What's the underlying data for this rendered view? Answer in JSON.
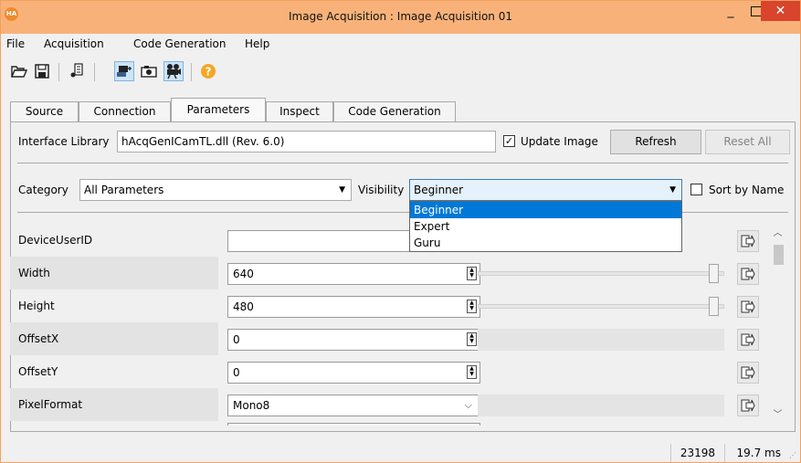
{
  "window": {
    "app_icon_text": "HA",
    "title": "Image Acquisition : Image Acquisition 01",
    "min_label": "_",
    "close_label": "✕"
  },
  "menu": {
    "items": [
      {
        "label": "File"
      },
      {
        "label": "Acquisition"
      },
      {
        "label": "Code Generation"
      },
      {
        "label": "Help"
      }
    ]
  },
  "toolbar": {
    "buttons": [
      {
        "icon": "open-folder-icon"
      },
      {
        "icon": "save-icon"
      },
      {
        "icon": "detect-icon"
      },
      {
        "icon": "connect-icon",
        "active": true
      },
      {
        "icon": "snap-icon"
      },
      {
        "icon": "live-icon",
        "active": true
      },
      {
        "icon": "help-icon"
      }
    ]
  },
  "tabs": [
    {
      "label": "Source"
    },
    {
      "label": "Connection"
    },
    {
      "label": "Parameters",
      "active": true
    },
    {
      "label": "Inspect"
    },
    {
      "label": "Code Generation"
    }
  ],
  "parameters": {
    "interface_label": "Interface Library",
    "interface_value": "hAcqGenICamTL.dll (Rev. 6.0)",
    "update_image_label": "Update Image",
    "update_image_checked": true,
    "update_image_check_glyph": "✓",
    "refresh_label": "Refresh",
    "reset_all_label": "Reset All",
    "category_label": "Category",
    "category_value": "All Parameters",
    "visibility_label": "Visibility",
    "visibility_value": "Beginner",
    "visibility_options": [
      "Beginner",
      "Expert",
      "Guru"
    ],
    "sort_by_name_label": "Sort by Name",
    "sort_by_name_checked": false
  },
  "rows": [
    {
      "name": "DeviceUserID",
      "value": "",
      "kind": "text"
    },
    {
      "name": "Width",
      "value": "640",
      "kind": "spin",
      "slider_fraction": 1.0
    },
    {
      "name": "Height",
      "value": "480",
      "kind": "spin",
      "slider_fraction": 1.0
    },
    {
      "name": "OffsetX",
      "value": "0",
      "kind": "spin"
    },
    {
      "name": "OffsetY",
      "value": "0",
      "kind": "spin"
    },
    {
      "name": "PixelFormat",
      "value": "Mono8",
      "kind": "enum"
    }
  ],
  "status": {
    "count": "23198",
    "time": "19.7 ms"
  },
  "colors": {
    "titlebar": "#f8b279",
    "close_button": "#d9442c",
    "selection": "#0078d7",
    "window_border": "#f3a05a"
  }
}
